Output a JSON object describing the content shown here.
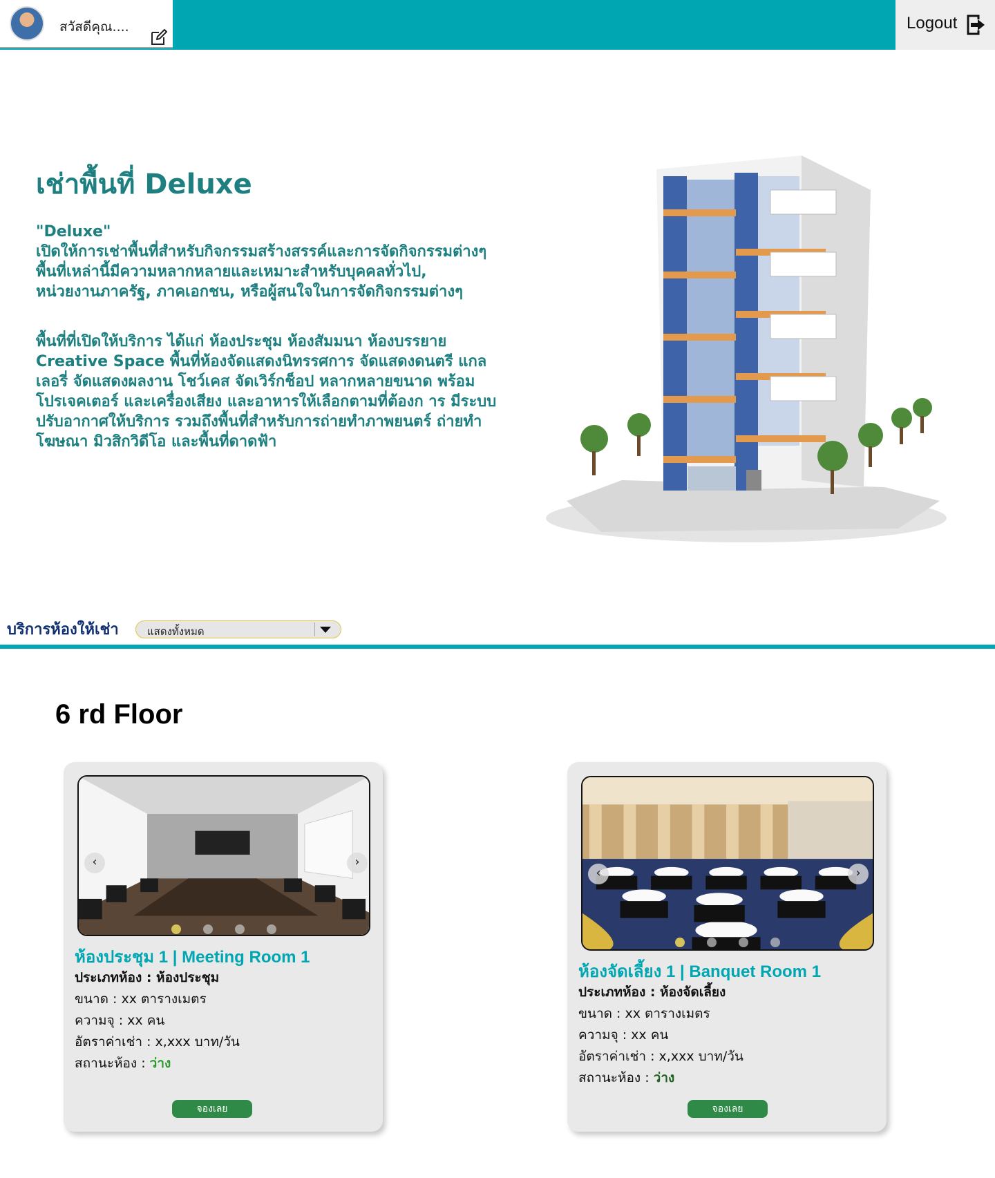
{
  "header": {
    "greeting": "สวัสดีคุณ....",
    "logout_label": "Logout"
  },
  "hero": {
    "title": "เช่าพื้นที่ Deluxe",
    "paragraph1": "\"Deluxe\"\nเปิดให้การเช่าพื้นที่สำหรับกิจกรรมสร้างสรรค์และการจัดกิจกรรมต่างๆ พื้นที่เหล่านี้มีความหลากหลายและเหมาะสำหรับบุคคลทั่วไป,\nหน่วยงานภาครัฐ, ภาคเอกชน, หรือผู้สนใจในการจัดกิจกรรมต่างๆ",
    "paragraph2": "พื้นที่ที่เปิดให้บริการ ได้แก่ ห้องประชุม ห้องสัมมนา ห้องบรรยาย Creative Space พื้นที่ห้องจัดแสดงนิทรรศการ จัดแสดงดนตรี แกลเลอรี่ จัดแสดงผลงาน โชว์เคส จัดเวิร์กช็อป หลากหลายขนาด พร้อมโปรเจคเตอร์ และเครื่องเสียง และอาหารให้เลือกตามที่ต้องก าร มีระบบปรับอากาศให้บริการ รวมถึงพื้นที่สำหรับการถ่ายทำภาพยนตร์ ถ่ายทำโฆษณา มิวสิกวิดีโอ และพื้นที่ดาดฟ้า"
  },
  "filter": {
    "label": "บริการห้องให้เช่า",
    "selected": "แสดงทั้งหมด"
  },
  "floor": {
    "title": "6 rd  Floor"
  },
  "rooms": [
    {
      "name": "ห้องประชุม 1 | Meeting Room 1",
      "type_label": "ประเภทห้อง : ห้องประชุม",
      "size_label": "ขนาด  :   xx ตารางเมตร",
      "capacity_label": "ความจุ :  xx คน",
      "rate_label": "อัตราค่าเช่า : x,xxx บาท/วัน",
      "status_label": "สถานะห้อง : ",
      "status_value": "ว่าง",
      "book_label": "จองเลย",
      "carousel_slide": 1,
      "carousel_total": 4
    },
    {
      "name": "ห้องจัดเลี้ยง 1 | Banquet Room 1",
      "type_label": "ประเภทห้อง : ห้องจัดเลี้ยง",
      "size_label": "ขนาด  :   xx ตารางเมตร",
      "capacity_label": "ความจุ :  xx คน",
      "rate_label": "อัตราค่าเช่า : x,xxx บาท/วัน",
      "status_label": "สถานะห้อง : ",
      "status_value": "ว่าง",
      "book_label": "จองเลย",
      "carousel_slide": 1,
      "carousel_total": 4
    }
  ],
  "colors": {
    "brand_teal": "#00a7b3",
    "hero_text": "#1d7f80",
    "book_button": "#2f8a47",
    "status_available": "#2e9a2e"
  },
  "icons": {
    "edit": "edit-icon",
    "logout": "logout-icon",
    "dropdown": "chevron-down-icon",
    "prev": "chevron-left-icon",
    "next": "chevron-right-icon"
  }
}
